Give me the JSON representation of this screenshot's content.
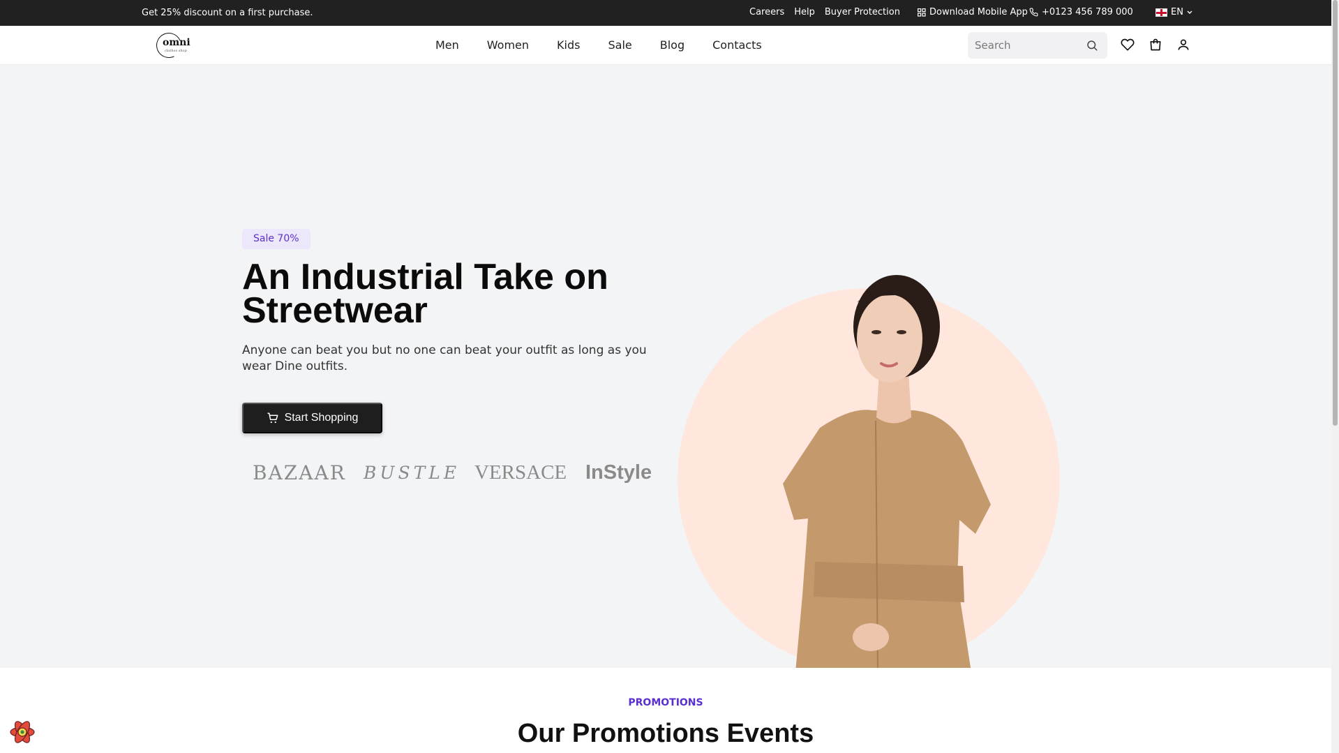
{
  "topbar": {
    "promo": "Get 25% discount on a first purchase.",
    "links": [
      "Careers",
      "Help",
      "Buyer Protection"
    ],
    "app": "Download Mobile App",
    "phone": "+0123 456 789 000",
    "lang": "EN"
  },
  "header": {
    "logo": {
      "word": "omni",
      "tag": "clothes shop"
    },
    "nav": [
      "Men",
      "Women",
      "Kids",
      "Sale",
      "Blog",
      "Contacts"
    ],
    "search": {
      "placeholder": "Search"
    }
  },
  "hero": {
    "badge": "Sale 70%",
    "title": "An Industrial Take on Streetwear",
    "subtitle": "Anyone can beat you but no one can beat your outfit as long as you wear Dine outfits.",
    "cta": "Start Shopping",
    "brands": [
      "BAZAAR",
      "BUSTLE",
      "VERSACE",
      "InStyle"
    ]
  },
  "promotions": {
    "label": "PROMOTIONS",
    "title": "Our Promotions Events"
  },
  "colors": {
    "accent": "#5b2fcf",
    "dark": "#1e1e1e",
    "hero_bg": "#f3f4f6",
    "circle": "#ffe7dd",
    "dress": "#c49a6c"
  }
}
